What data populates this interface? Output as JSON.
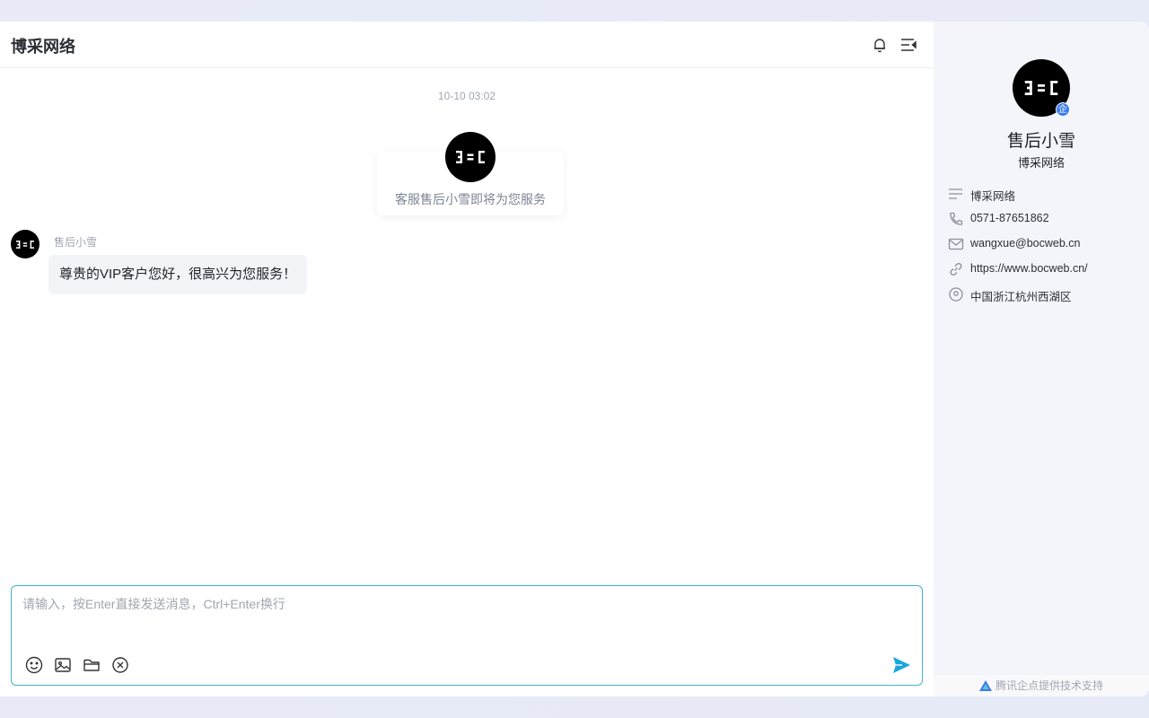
{
  "header": {
    "title": "博采网络",
    "icons": [
      "bell-icon",
      "collapse-menu-icon"
    ]
  },
  "chat": {
    "timestamp": "10-10 03:02",
    "welcome": "客服售后小雪即将为您服务",
    "messages": [
      {
        "sender": "售后小雪",
        "text": "尊贵的VIP客户您好，很高兴为您服务！"
      }
    ]
  },
  "composer": {
    "placeholder": "请输入，按Enter直接发送消息，Ctrl+Enter换行",
    "value": "",
    "tools": [
      "emoji-icon",
      "image-icon",
      "folder-icon",
      "close-circle-icon"
    ],
    "send_icon": "send-icon"
  },
  "profile": {
    "name": "售后小雪",
    "company": "博采网络",
    "badge": "企",
    "info": [
      {
        "icon": "list-icon",
        "text": "博采网络"
      },
      {
        "icon": "phone-icon",
        "text": "0571-87651862"
      },
      {
        "icon": "mail-icon",
        "text": "wangxue@bocweb.cn"
      },
      {
        "icon": "link-icon",
        "text": "https://www.bocweb.cn/"
      },
      {
        "icon": "location-icon",
        "text": "中国浙江杭州西湖区"
      }
    ]
  },
  "footer": {
    "text": "腾讯企点提供技术支持"
  },
  "colors": {
    "accent": "#3fb5c9",
    "send": "#1aa6e0",
    "badge": "#3a7cf0"
  }
}
